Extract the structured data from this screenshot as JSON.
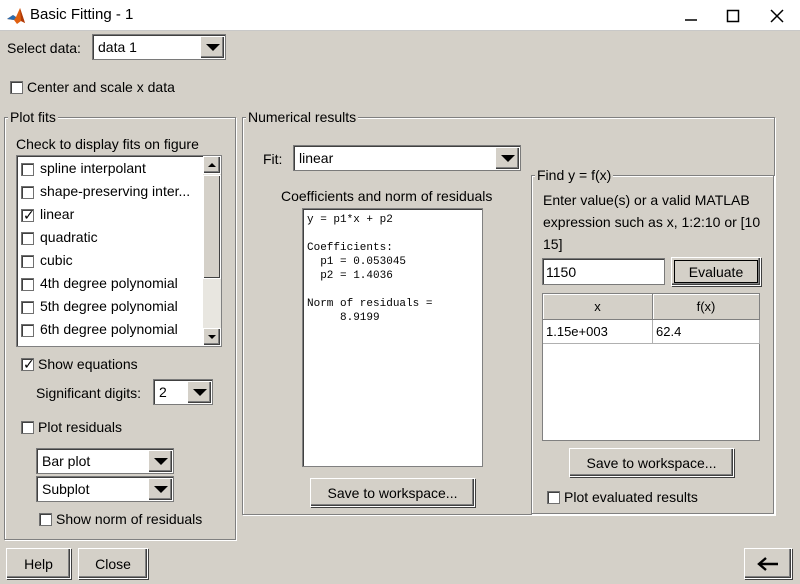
{
  "window": {
    "title": "Basic Fitting - 1",
    "minimize_glyph": "—",
    "maximize_glyph": "☐",
    "close_glyph": "✕"
  },
  "select_data": {
    "label": "Select data:",
    "value": "data 1"
  },
  "center_scale": {
    "label": "Center and scale x data",
    "checked": false
  },
  "plot_fits": {
    "title": "Plot fits",
    "instruction": "Check to display fits on figure",
    "items": [
      {
        "label": "spline interpolant",
        "checked": false
      },
      {
        "label": "shape-preserving inter...",
        "checked": false
      },
      {
        "label": "linear",
        "checked": true
      },
      {
        "label": "quadratic",
        "checked": false
      },
      {
        "label": "cubic",
        "checked": false
      },
      {
        "label": "4th degree polynomial",
        "checked": false
      },
      {
        "label": "5th degree polynomial",
        "checked": false
      },
      {
        "label": "6th degree polynomial",
        "checked": false
      }
    ],
    "show_equations": {
      "label": "Show equations",
      "checked": true
    },
    "significant_digits": {
      "label": "Significant digits:",
      "value": "2"
    },
    "plot_residuals": {
      "label": "Plot residuals",
      "checked": false
    },
    "residual_plot_type": "Bar plot",
    "residual_location": "Subplot",
    "show_norm": {
      "label": "Show norm of residuals",
      "checked": false
    }
  },
  "numerical": {
    "title": "Numerical results",
    "fit_label": "Fit:",
    "fit_value": "linear",
    "coeff_title": "Coefficients and norm of residuals",
    "results_text": "y = p1*x + p2\n\nCoefficients:\n  p1 = 0.053045\n  p2 = 1.4036\n\nNorm of residuals =\n     8.9199",
    "save_label": "Save to workspace..."
  },
  "find": {
    "title": "Find y = f(x)",
    "instruction": "Enter value(s) or a valid MATLAB expression such as x, 1:2:10 or [10 15]",
    "input_value": "1150",
    "evaluate_label": "Evaluate",
    "table": {
      "headers": [
        "x",
        "f(x)"
      ],
      "rows": [
        [
          "1.15e+003",
          "62.4"
        ]
      ]
    },
    "save_label": "Save to workspace...",
    "plot_evaluated": {
      "label": "Plot evaluated results",
      "checked": false
    }
  },
  "footer": {
    "help_label": "Help",
    "close_label": "Close",
    "back_glyph": "←"
  }
}
